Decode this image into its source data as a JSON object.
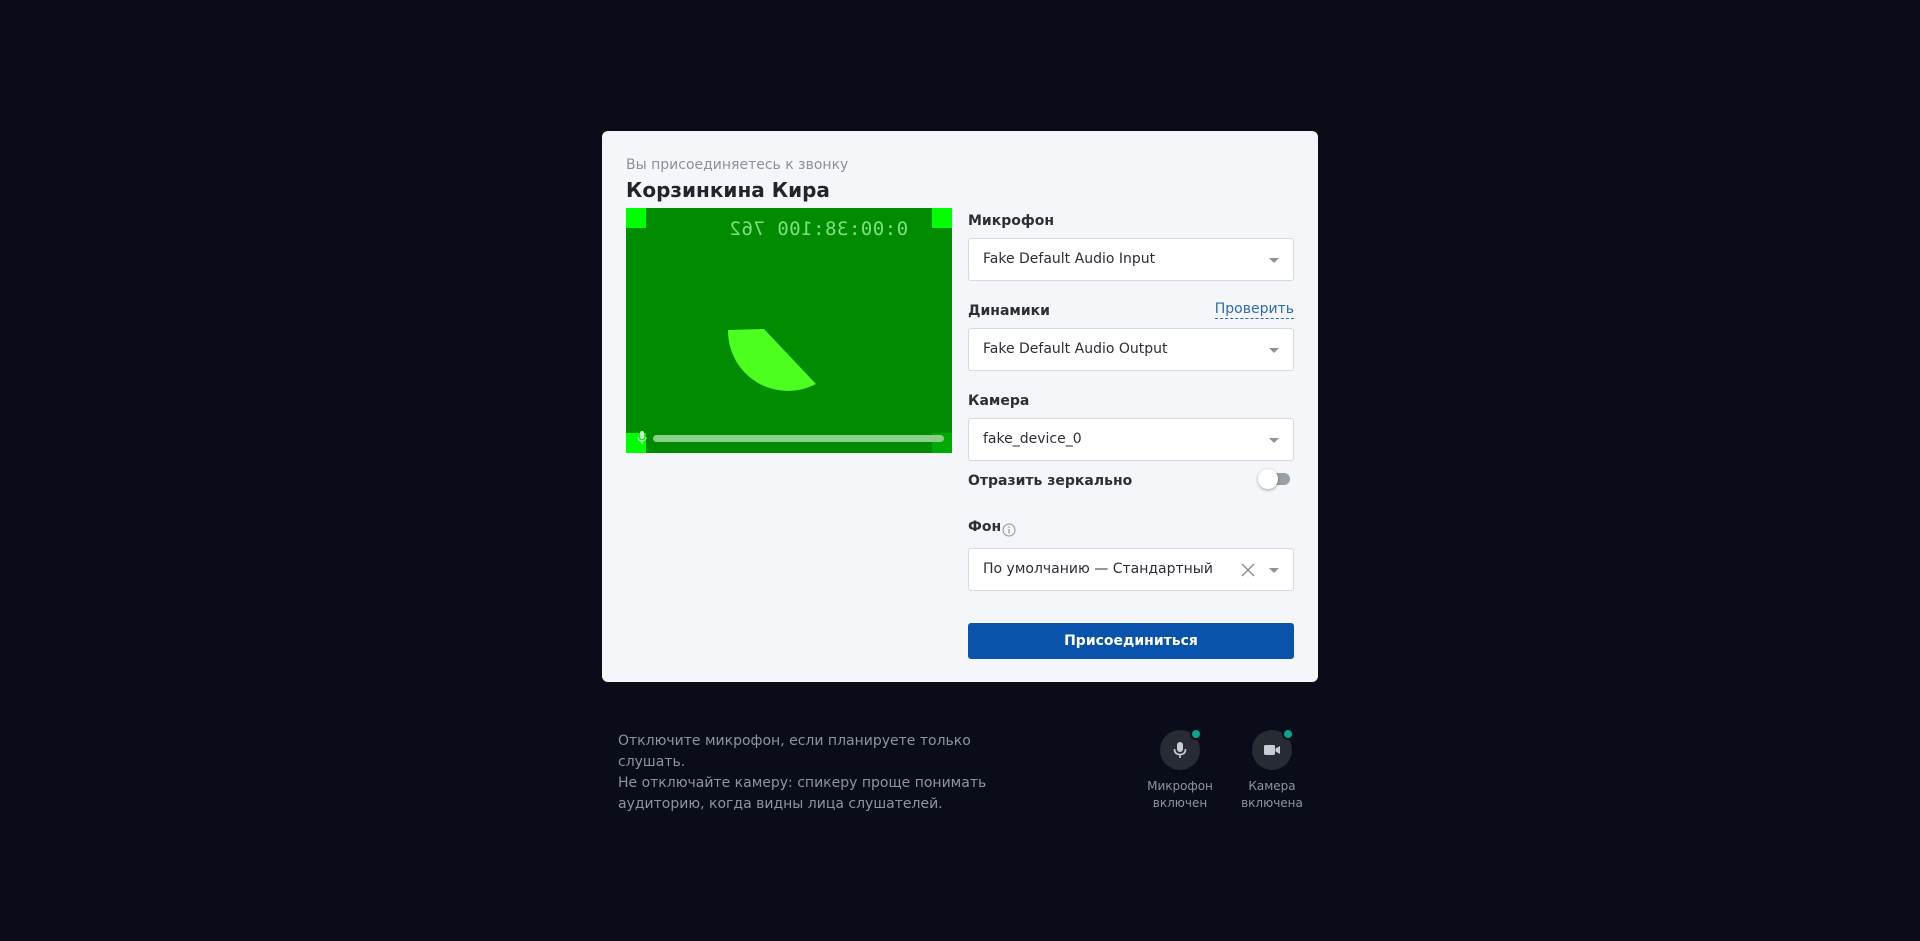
{
  "header": {
    "subtitle": "Вы присоединяетесь к звонку",
    "name": "Корзинкина Кира"
  },
  "preview": {
    "timecode": "0:00:38:100 762",
    "mic_level": 1.0
  },
  "microphone": {
    "label": "Микрофон",
    "value": "Fake Default Audio Input"
  },
  "speakers": {
    "label": "Динамики",
    "value": "Fake Default Audio Output",
    "test_link": "Проверить"
  },
  "camera": {
    "label": "Камера",
    "value": "fake_device_0"
  },
  "mirror": {
    "label": "Отразить зеркально",
    "enabled": false
  },
  "background": {
    "label": "Фон",
    "value": "По умолчанию — Стандартный"
  },
  "join_button": "Присоединиться",
  "hint": {
    "line1": "Отключите микрофон, если планируете только слушать.",
    "line2": "Не отключайте камеру: спикеру проще понимать",
    "line3": "аудиторию, когда видны лица слушателей."
  },
  "controls": {
    "mic": {
      "line1": "Микрофон",
      "line2": "включен",
      "icon": "microphone-icon"
    },
    "cam": {
      "line1": "Камера",
      "line2": "включена",
      "icon": "camera-icon"
    }
  },
  "colors": {
    "accent": "#0a53ad",
    "status_on": "#08a68a",
    "preview_bg": "#008b00"
  }
}
